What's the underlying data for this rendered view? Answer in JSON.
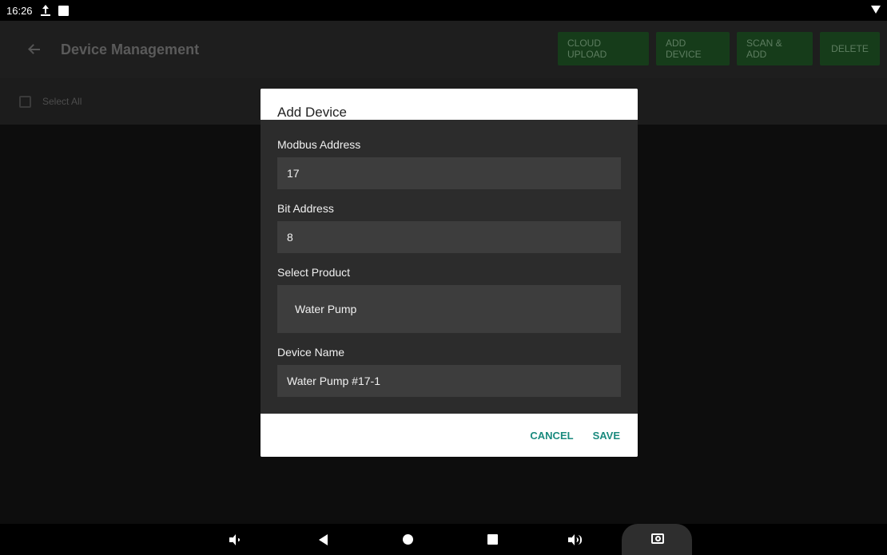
{
  "status_bar": {
    "time": "16:26"
  },
  "app_bar": {
    "title": "Device Management",
    "actions": {
      "cloud_upload": "CLOUD UPLOAD",
      "add_device": "ADD DEVICE",
      "scan_add": "SCAN & ADD",
      "delete": "DELETE"
    }
  },
  "select_all": {
    "label": "Select All",
    "checked": false
  },
  "dialog": {
    "title": "Add Device",
    "fields": {
      "modbus_address": {
        "label": "Modbus Address",
        "value": "17"
      },
      "bit_address": {
        "label": "Bit Address",
        "value": "8"
      },
      "product": {
        "label": "Select Product",
        "value": "Water Pump"
      },
      "device_name": {
        "label": "Device Name",
        "value": "Water Pump #17-1"
      }
    },
    "buttons": {
      "cancel": "CANCEL",
      "save": "SAVE"
    }
  },
  "icons": {
    "status": [
      "upload-icon",
      "notification-square-icon",
      "wifi-icon"
    ],
    "nav": [
      "volume-down-icon",
      "back-icon",
      "home-icon",
      "recents-icon",
      "volume-up-icon",
      "camera-icon"
    ]
  },
  "colors": {
    "accent": "#1a8a7e",
    "action_button_bg": "#163c1a",
    "dialog_body_bg": "#2c2c2c",
    "field_bg": "#3d3d3d"
  }
}
